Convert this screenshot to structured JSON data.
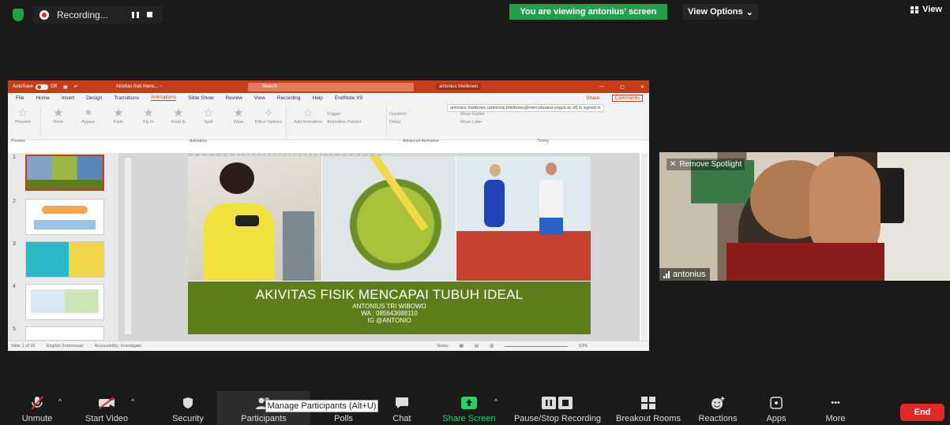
{
  "recording": {
    "label": "Recording..."
  },
  "banner": {
    "viewing": "You are viewing antonius' screen",
    "view_options": "View Options",
    "view": "View"
  },
  "ppt": {
    "autosave": "AutoSave",
    "autosave_state": "Off",
    "file_title": "Akivitas fisik menc... ~",
    "search_placeholder": "Search",
    "user": "antonius triwibowo",
    "tabs": [
      "File",
      "Home",
      "Insert",
      "Design",
      "Transitions",
      "Animations",
      "Slide Show",
      "Review",
      "View",
      "Recording",
      "Help",
      "EndNote X9"
    ],
    "active_tab": "Animations",
    "share": "Share",
    "comments": "Comments",
    "signed_in": "antonius triwibowo (antonius.triwibowo@mercubuana-yogya.ac.id) is signed in",
    "ribbon_items": [
      "Preview",
      "None",
      "Appear",
      "Fade",
      "Fly In",
      "Float In",
      "Split",
      "Wipe",
      "Effect Options"
    ],
    "ribbon_add": "Add Animation",
    "ribbon_trigger": "Trigger",
    "ribbon_painter": "Animation Painter",
    "ribbon_duration": "Duration:",
    "ribbon_delay": "Delay:",
    "ribbon_earlier": "Move Earlier",
    "ribbon_later": "Move Later",
    "group_preview": "Preview",
    "group_animation": "Animation",
    "group_advanced": "Advanced Animation",
    "group_timing": "Timing",
    "ruler": "16 · 15 · 14 · 13 · 12 · 11 · 10 · 9 · 8 · 7 · 6 · 5 · 4 · 3 · 2 · 1 · 0 · 1 · 2 · 3 · 4 · 5 · 6 · 7 · 8 · 9 · 10 · 11 · 12 · 13 · 14 · 15 · 16",
    "thumbs": [
      "1",
      "2",
      "3",
      "4",
      "5"
    ],
    "slide_title": "AKIVITAS FISIK MENCAPAI TUBUH IDEAL",
    "slide_author": "ANTONIUS TRI WIBOWO",
    "slide_wa": "WA : 085643688110",
    "slide_ig": "IG @ANTONIO",
    "status_slide": "Slide 1 of 16",
    "status_lang": "English (Indonesia)",
    "status_access": "Accessibility: Investigate",
    "status_notes": "Notes",
    "zoom": "63%"
  },
  "cam": {
    "spotlight": "Remove Spotlight",
    "name": "antonius"
  },
  "toolbar": {
    "unmute": "Unmute",
    "start_video": "Start Video",
    "security": "Security",
    "participants": "Participants",
    "polls": "Polls",
    "chat": "Chat",
    "share_screen": "Share Screen",
    "pause_recording": "Pause/Stop Recording",
    "breakout": "Breakout Rooms",
    "reactions": "Reactions",
    "apps": "Apps",
    "more": "More",
    "end": "End",
    "tooltip": "Manage Participants (Alt+U)"
  },
  "colors": {
    "accent_green": "#23a04a",
    "ppt_brand": "#c43e1c",
    "slide_banner": "#5e7e1c",
    "end_red": "#e02a2a"
  }
}
